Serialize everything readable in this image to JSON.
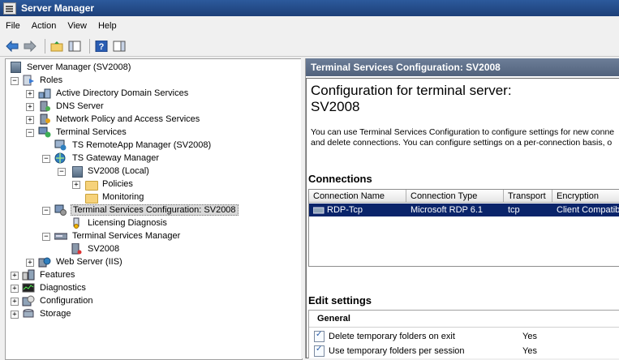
{
  "window": {
    "title": "Server Manager"
  },
  "menu": [
    "File",
    "Action",
    "View",
    "Help"
  ],
  "toolbar": {
    "buttons": [
      "back-arrow-icon",
      "forward-arrow-icon",
      "up-folder-icon",
      "show-hide-tree-icon",
      "help-icon",
      "show-hide-action-pane-icon"
    ]
  },
  "tree": {
    "root": "Server Manager (SV2008)",
    "roles": "Roles",
    "ad": "Active Directory Domain Services",
    "dns": "DNS Server",
    "npas": "Network Policy and Access Services",
    "ts": "Terminal Services",
    "remoteapp": "TS RemoteApp Manager (SV2008)",
    "gateway": "TS Gateway Manager",
    "gw_local": "SV2008 (Local)",
    "policies": "Policies",
    "monitoring": "Monitoring",
    "tsconfig": "Terminal Services Configuration: SV2008",
    "licensing": "Licensing Diagnosis",
    "tsmanager": "Terminal Services Manager",
    "tsm_sv": "SV2008",
    "iis": "Web Server (IIS)",
    "features": "Features",
    "diagnostics": "Diagnostics",
    "configuration": "Configuration",
    "storage": "Storage"
  },
  "right": {
    "header": "Terminal Services Configuration: SV2008",
    "cfg_title_line1": "Configuration for terminal server:",
    "cfg_title_line2": "SV2008",
    "desc_line1": "You can use Terminal Services Configuration to configure settings for new conne",
    "desc_line2": "and delete connections. You can configure settings on a per-connection basis, o",
    "connections_heading": "Connections",
    "columns": [
      "Connection Name",
      "Connection Type",
      "Transport",
      "Encryption"
    ],
    "rows": [
      {
        "name": "RDP-Tcp",
        "type": "Microsoft RDP 6.1",
        "transport": "tcp",
        "encryption": "Client Compatible"
      }
    ],
    "edit_heading": "Edit settings",
    "general_heading": "General",
    "settings": [
      {
        "label": "Delete temporary folders on exit",
        "value": "Yes"
      },
      {
        "label": "Use temporary folders per session",
        "value": "Yes"
      }
    ]
  },
  "colors": {
    "selection": "#0a246a",
    "title_bar": "#1d3f78",
    "pane_header": "#5a6b85"
  }
}
